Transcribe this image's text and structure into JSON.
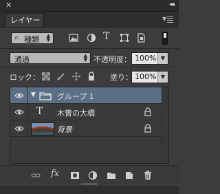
{
  "window": {
    "close_glyph": "✕",
    "collapse_glyph": "◂◂"
  },
  "panel": {
    "tab_label": "レイヤー",
    "menu_icon": "panel-menu-icon"
  },
  "filter": {
    "kind_label": "種類",
    "icons": [
      "pixel-filter-icon",
      "adjustment-filter-icon",
      "type-filter-icon",
      "shape-filter-icon",
      "smart-object-filter-icon"
    ],
    "type_glyph": "T"
  },
  "blend": {
    "mode": "通過",
    "opacity_label": "不透明度：",
    "opacity_value": "100%"
  },
  "lock": {
    "label": "ロック：",
    "fill_label": "塗り：",
    "fill_value": "100%"
  },
  "layers": [
    {
      "name": "グループ 1",
      "type": "group",
      "selected": true,
      "locked": false
    },
    {
      "name": "木曽の大橋",
      "type": "text",
      "selected": false,
      "locked": true,
      "type_glyph": "T"
    },
    {
      "name": "背景",
      "type": "image",
      "selected": false,
      "locked": true
    }
  ],
  "bottom_bar": {
    "fx_label": "fx",
    "icons": [
      "link-layers-icon",
      "fx-icon",
      "add-mask-icon",
      "adjustment-layer-icon",
      "new-group-icon",
      "new-layer-icon",
      "delete-layer-icon"
    ]
  },
  "colors": {
    "selected_row": "#5b6f85",
    "panel_bg": "#3c3c3c"
  }
}
